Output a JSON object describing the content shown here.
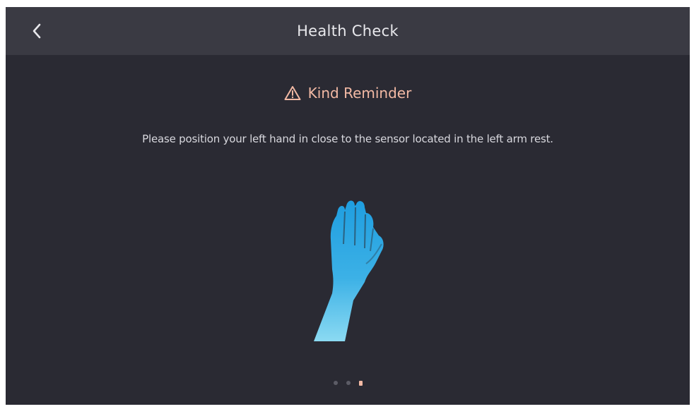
{
  "header": {
    "title": "Health Check",
    "back_icon": "chevron-left-icon"
  },
  "reminder": {
    "icon": "warning-triangle-icon",
    "label": "Kind Reminder"
  },
  "instruction": {
    "text": "Please position your left hand in close to the sensor located in the left arm rest."
  },
  "illustration": {
    "icon": "hand-icon"
  },
  "pager": {
    "pages": 3,
    "active_index": 2
  },
  "colors": {
    "background": "#2a2a33",
    "header": "#3a3a43",
    "accent": "#f2b9a4",
    "hand_gradient_top": "#1f9ee0",
    "hand_gradient_bottom": "#7fd6f0"
  }
}
